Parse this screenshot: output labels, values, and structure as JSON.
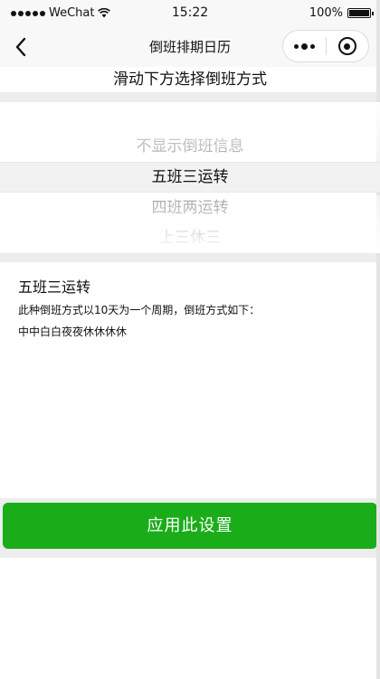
{
  "status_bar": {
    "carrier": "WeChat",
    "time": "15:22",
    "battery": "100%",
    "battery_level": 1.0
  },
  "nav": {
    "title": "倒班排期日历",
    "back_icon": "chevron-left-icon",
    "more_icon": "more-dots-icon",
    "close_icon": "target-circle-icon"
  },
  "page": {
    "heading": "滑动下方选择倒班方式"
  },
  "picker": {
    "options": [
      "不显示倒班信息",
      "五班三运转",
      "四班两运转",
      "上三休三"
    ],
    "selected_index": 1
  },
  "description": {
    "title": "五班三运转",
    "text": "此种倒班方式以10天为一个周期，倒班方式如下：",
    "pattern": "中中白白夜夜休休休休"
  },
  "actions": {
    "apply_label": "应用此设置"
  },
  "colors": {
    "primary_green": "#1aad19",
    "page_bg": "#ededed"
  }
}
